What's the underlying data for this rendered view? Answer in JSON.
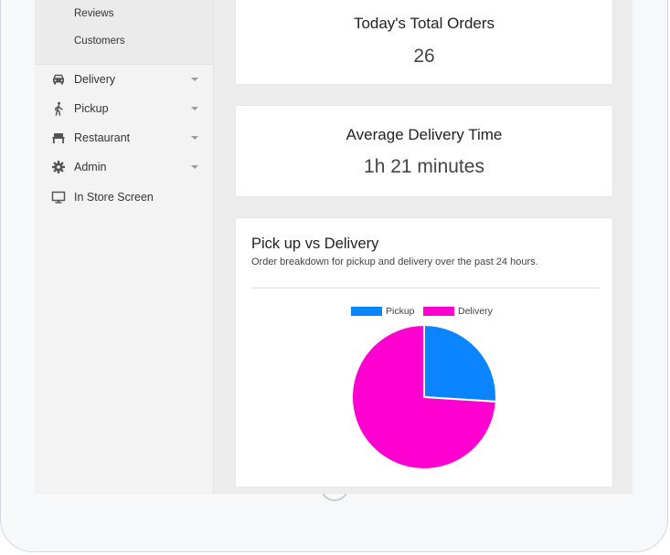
{
  "sidebar": {
    "subitems": [
      {
        "label": "Reviews"
      },
      {
        "label": "Customers"
      }
    ],
    "items": [
      {
        "label": "Delivery",
        "icon": "car-icon"
      },
      {
        "label": "Pickup",
        "icon": "walking-person-icon"
      },
      {
        "label": "Restaurant",
        "icon": "restaurant-table-icon"
      },
      {
        "label": "Admin",
        "icon": "gear-icon"
      },
      {
        "label": "In Store Screen",
        "icon": "monitor-icon"
      }
    ]
  },
  "stats": {
    "orders": {
      "title": "Today's Total Orders",
      "value": "26"
    },
    "delivery_time": {
      "title": "Average Delivery Time",
      "value": "1h 21 minutes"
    }
  },
  "chart_card": {
    "title": "Pick up vs Delivery",
    "subtitle": "Order breakdown for pickup and delivery over the past 24 hours."
  },
  "chart_data": {
    "type": "pie",
    "labels": [
      "Pickup",
      "Delivery"
    ],
    "values": [
      26,
      74
    ],
    "colors": [
      "#0a84ff",
      "#ff00d0"
    ],
    "legend_position": "top"
  }
}
